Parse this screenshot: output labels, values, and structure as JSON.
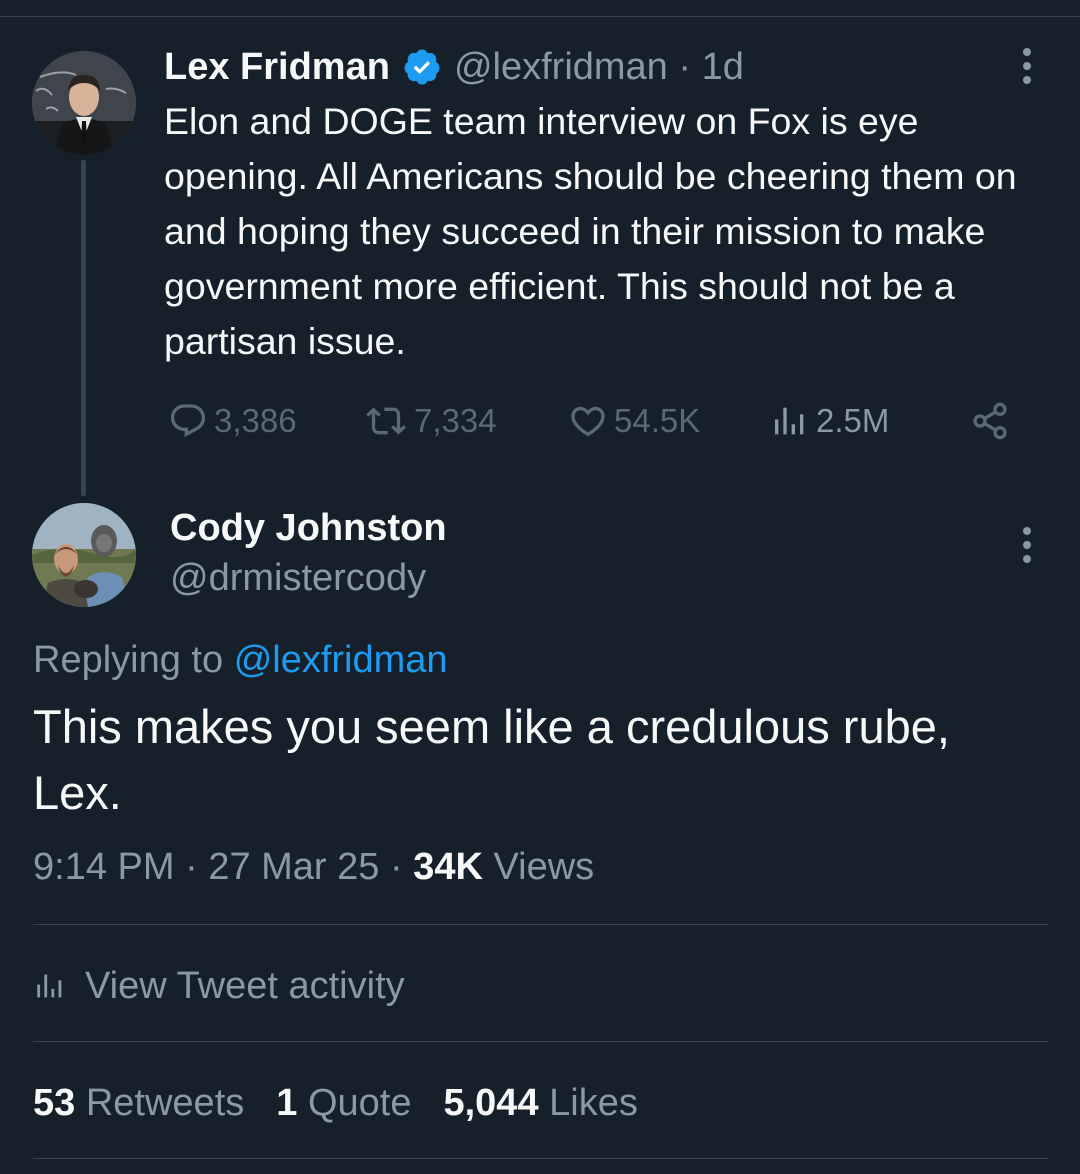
{
  "parent_tweet": {
    "author_name": "Lex Fridman",
    "handle": "@lexfridman",
    "time": "1d",
    "separator": "·",
    "verified_icon": "verified-badge-icon",
    "text": "Elon and DOGE team interview on Fox is eye opening. All Americans should be cheering them on and hoping they succeed in their mission to make government more efficient. This should not be a partisan issue.",
    "actions": {
      "replies": "3,386",
      "retweets": "7,334",
      "likes": "54.5K",
      "views": "2.5M"
    }
  },
  "reply_tweet": {
    "author_name": "Cody Johnston",
    "handle": "@drmistercody",
    "replying_prefix": "Replying to",
    "replying_to": "@lexfridman",
    "text": "This makes you seem like a credulous rube, Lex.",
    "time": "9:14 PM",
    "date": "27 Mar 25",
    "views_count": "34K",
    "views_label": "Views"
  },
  "activity_label": "View Tweet activity",
  "stats": {
    "retweets_count": "53",
    "retweets_label": "Retweets",
    "quotes_count": "1",
    "quotes_label": "Quote",
    "likes_count": "5,044",
    "likes_label": "Likes"
  },
  "colors": {
    "background": "#15202b",
    "text_primary": "#f7f9f9",
    "text_secondary": "#8b98a5",
    "accent": "#1d9bf0",
    "divider": "#38444d"
  }
}
